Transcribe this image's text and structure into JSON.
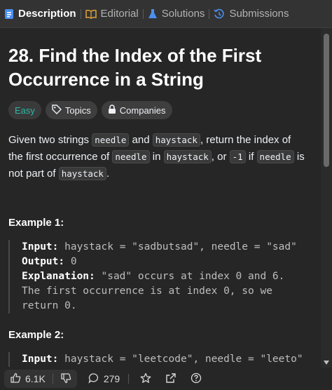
{
  "tabs": [
    {
      "label": "Description",
      "icon": "description-icon",
      "active": true
    },
    {
      "label": "Editorial",
      "icon": "book-icon",
      "active": false
    },
    {
      "label": "Solutions",
      "icon": "flask-icon",
      "active": false
    },
    {
      "label": "Submissions",
      "icon": "history-icon",
      "active": false
    }
  ],
  "problem": {
    "title": "28. Find the Index of the First Occurrence in a String",
    "difficulty": "Easy",
    "topics_label": "Topics",
    "companies_label": "Companies",
    "description": {
      "p1": "Given two strings ",
      "c1": "needle",
      "p2": " and ",
      "c2": "haystack",
      "p3": ", return the index of the first occurrence of ",
      "c3": "needle",
      "p4": " in ",
      "c4": "haystack",
      "p5": ", or ",
      "c5": "-1",
      "p6": " if ",
      "c6": "needle",
      "p7": " is not part of ",
      "c7": "haystack",
      "p8": "."
    }
  },
  "examples": [
    {
      "title": "Example 1:",
      "input_label": "Input:",
      "input_value": " haystack = \"sadbutsad\", needle = \"sad\"",
      "output_label": "Output:",
      "output_value": " 0",
      "explanation_label": "Explanation:",
      "explanation_value": " \"sad\" occurs at index 0 and 6.",
      "explanation_line2": "The first occurrence is at index 0, so we",
      "explanation_line3": "return 0."
    },
    {
      "title": "Example 2:",
      "input_label": "Input:",
      "input_value": " haystack = \"leetcode\", needle = \"leeto\""
    }
  ],
  "actions": {
    "likes": "6.1K",
    "comments": "279"
  },
  "colors": {
    "easy": "#2bb8a6",
    "background": "#262626",
    "tabbar": "#333333"
  }
}
